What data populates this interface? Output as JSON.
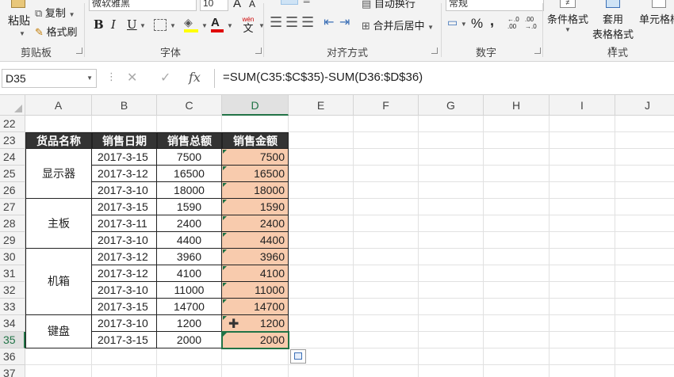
{
  "ribbon": {
    "clipboard": {
      "paste_label": "粘贴",
      "copy_label": "复制",
      "format_painter_label": "格式刷",
      "group_label": "剪贴板"
    },
    "font": {
      "font_name": "微软雅黑",
      "font_size": "10",
      "bold": "B",
      "italic": "I",
      "underline": "U",
      "wen": "wén",
      "wen_char": "文",
      "font_color_letter": "A",
      "group_label": "字体",
      "grow": "A",
      "shrink": "A",
      "highlight_color": "#ffff00",
      "font_color": "#e00000"
    },
    "alignment": {
      "wrap_label": "自动换行",
      "merge_label": "合并后居中",
      "group_label": "对齐方式"
    },
    "number": {
      "format_value": "常规",
      "percent": "%",
      "comma": ",",
      "inc_top": "←.0",
      "inc_bottom": ".00",
      "dec_top": ".00",
      "dec_bottom": "→.0",
      "group_label": "数字"
    },
    "styles": {
      "conditional_label": "条件格式",
      "table_format_line1": "套用",
      "table_format_line2": "表格格式",
      "cell_styles_label": "单元格样",
      "group_label": "样式"
    }
  },
  "formula_bar": {
    "name_box": "D35",
    "fx": "fx",
    "formula": "=SUM(C35:$C$35)-SUM(D36:$D$36)"
  },
  "columns": [
    "A",
    "B",
    "C",
    "D",
    "E",
    "F",
    "G",
    "H",
    "I",
    "J"
  ],
  "selected_column": "D",
  "rows": [
    "22",
    "23",
    "24",
    "25",
    "26",
    "27",
    "28",
    "29",
    "30",
    "31",
    "32",
    "33",
    "34",
    "35",
    "36",
    "37"
  ],
  "selected_row": "35",
  "table": {
    "headers": [
      "货品名称",
      "销售日期",
      "销售总额",
      "销售金额"
    ],
    "categories": [
      {
        "name": "显示器"
      },
      {
        "name": "主板"
      },
      {
        "name": "机箱"
      },
      {
        "name": "键盘"
      }
    ],
    "data_rows": [
      {
        "date": "2017-3-15",
        "total": "7500",
        "amount": "7500"
      },
      {
        "date": "2017-3-12",
        "total": "16500",
        "amount": "16500"
      },
      {
        "date": "2017-3-10",
        "total": "18000",
        "amount": "18000"
      },
      {
        "date": "2017-3-15",
        "total": "1590",
        "amount": "1590"
      },
      {
        "date": "2017-3-11",
        "total": "2400",
        "amount": "2400"
      },
      {
        "date": "2017-3-10",
        "total": "4400",
        "amount": "4400"
      },
      {
        "date": "2017-3-12",
        "total": "3960",
        "amount": "3960"
      },
      {
        "date": "2017-3-12",
        "total": "4100",
        "amount": "4100"
      },
      {
        "date": "2017-3-10",
        "total": "11000",
        "amount": "11000"
      },
      {
        "date": "2017-3-15",
        "total": "14700",
        "amount": "14700"
      },
      {
        "date": "2017-3-10",
        "total": "1200",
        "amount": "1200"
      },
      {
        "date": "2017-3-15",
        "total": "2000",
        "amount": "2000"
      }
    ]
  },
  "colors": {
    "accent": "#217346",
    "header_fill": "#333333",
    "amount_fill": "#f8cbad"
  }
}
